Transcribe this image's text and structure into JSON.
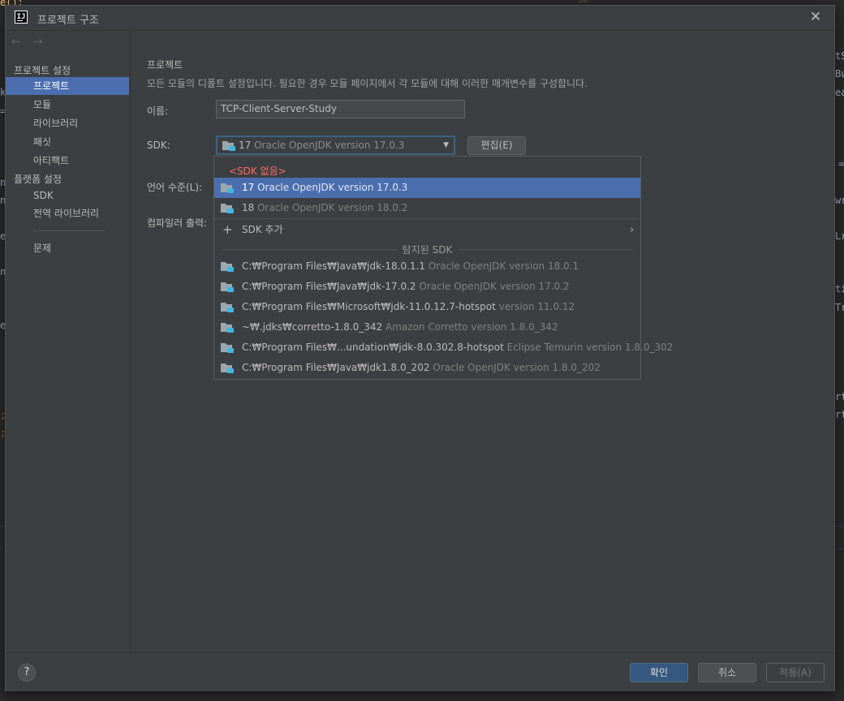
{
  "background_editor": {
    "top_line_number": "30",
    "fragments": [
      "e();",
      "k",
      "=",
      "n",
      "n",
      "e",
      "n",
      "e",
      ";",
      ";",
      "tS",
      "Bu",
      "ea",
      "=",
      "wr",
      "Lr",
      "ti",
      "Tr",
      "rt",
      "rt"
    ]
  },
  "dialog": {
    "title": "프로젝트 구조",
    "app_icon_text": "IJ"
  },
  "sidebar": {
    "back_arrow": "←",
    "forward_arrow": "→",
    "project_settings_header": "프로젝트 설정",
    "project_items": [
      {
        "label": "프로젝트",
        "active": true
      },
      {
        "label": "모듈",
        "active": false
      },
      {
        "label": "라이브러리",
        "active": false
      },
      {
        "label": "패싯",
        "active": false
      },
      {
        "label": "아티팩트",
        "active": false
      }
    ],
    "platform_settings_header": "플랫폼 설정",
    "platform_items": [
      {
        "label": "SDK"
      },
      {
        "label": "전역 라이브러리"
      }
    ],
    "problems_label": "문제"
  },
  "content": {
    "section_title": "프로젝트",
    "section_desc": "모든 모듈의 디폴트 설정입니다. 필요한 경우 모듈 페이지에서 각 모듈에 대해 이러한 매개변수를 구성합니다.",
    "name_label": "이름:",
    "name_value": "TCP-Client-Server-Study",
    "sdk_label": "SDK:",
    "sdk_selected_version": "17",
    "sdk_selected_desc": "Oracle OpenJDK version 17.0.3",
    "edit_button": "편집(E)",
    "language_level_label": "언어 수준(L):",
    "compiler_output_label": "컴파일러 출력:"
  },
  "dropdown": {
    "no_sdk": "<SDK 없음>",
    "sdks": [
      {
        "version": "17",
        "desc": "Oracle OpenJDK version 17.0.3",
        "selected": true
      },
      {
        "version": "18",
        "desc": "Oracle OpenJDK version 18.0.2",
        "selected": false
      }
    ],
    "add_sdk": "SDK 추가",
    "detected_header": "탐지된 SDK",
    "detected": [
      {
        "path": "C:₩Program Files₩Java₩jdk-18.0.1.1",
        "desc": "Oracle OpenJDK version 18.0.1"
      },
      {
        "path": "C:₩Program Files₩Java₩jdk-17.0.2",
        "desc": "Oracle OpenJDK version 17.0.2"
      },
      {
        "path": "C:₩Program Files₩Microsoft₩jdk-11.0.12.7-hotspot",
        "desc": "version 11.0.12"
      },
      {
        "path": "~₩.jdks₩corretto-1.8.0_342",
        "desc": "Amazon Corretto version 1.8.0_342"
      },
      {
        "path": "C:₩Program Files₩...undation₩jdk-8.0.302.8-hotspot",
        "desc": "Eclipse Temurin version 1.8.0_302"
      },
      {
        "path": "C:₩Program Files₩Java₩jdk1.8.0_202",
        "desc": "Oracle OpenJDK version 1.8.0_202"
      }
    ]
  },
  "footer": {
    "help": "?",
    "ok": "확인",
    "cancel": "취소",
    "apply": "적용(A)"
  },
  "colors": {
    "accent_selection": "#4b6eaf",
    "dialog_bg": "#3c3f41",
    "no_sdk_red": "#ff6b68",
    "folder_icon": "#9aa7b0",
    "folder_badge": "#40b6e0"
  }
}
